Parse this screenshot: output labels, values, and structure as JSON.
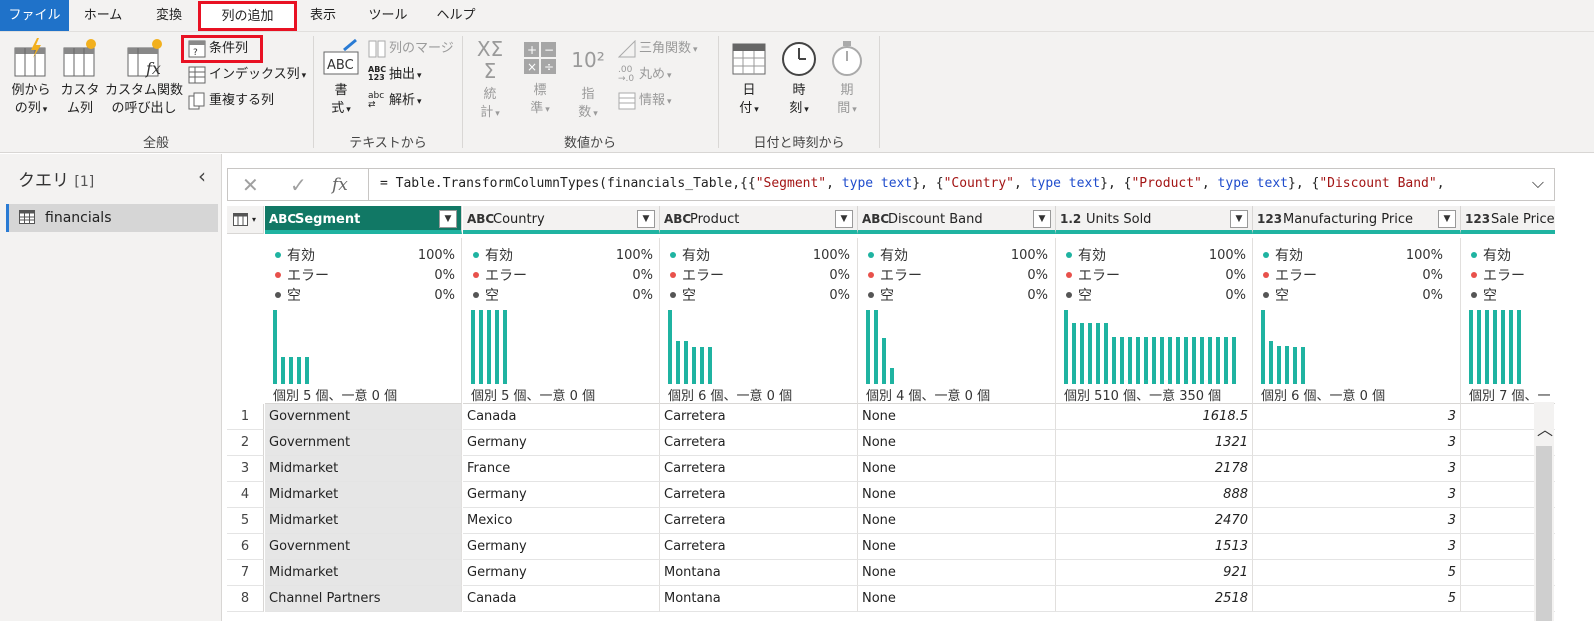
{
  "menu": {
    "file": "ファイル",
    "home": "ホーム",
    "transform": "変換",
    "add_column": "列の追加",
    "view": "表示",
    "tools": "ツール",
    "help": "ヘルプ"
  },
  "ribbon": {
    "general": {
      "label": "全般",
      "from_examples": [
        "例から",
        "の列"
      ],
      "custom_column": [
        "カスタ",
        "ム列"
      ],
      "invoke_custom_function": [
        "カスタム関数",
        "の呼び出し"
      ],
      "conditional_column": "条件列",
      "index_column": "インデックス列",
      "duplicate_column": "重複する列"
    },
    "from_text": {
      "label": "テキストから",
      "format": [
        "書",
        "式"
      ],
      "merge_columns": "列のマージ",
      "extract": "抽出",
      "parse": "解析"
    },
    "from_number": {
      "label": "数値から",
      "statistics": [
        "統",
        "計"
      ],
      "standard": [
        "標",
        "準"
      ],
      "scientific": [
        "指",
        "数"
      ],
      "trigonometry": "三角関数",
      "rounding": "丸め",
      "information": "情報"
    },
    "from_datetime": {
      "label": "日付と時刻から",
      "date": [
        "日",
        "付"
      ],
      "time": [
        "時",
        "刻"
      ],
      "duration": [
        "期",
        "間"
      ]
    }
  },
  "queries": {
    "title": "クエリ",
    "count": "[1]",
    "items": [
      "financials"
    ]
  },
  "formula": {
    "prefix": "= Table.TransformColumnTypes(financials_Table,{{",
    "parts": [
      {
        "t": "str",
        "v": "\"Segment\""
      },
      {
        "t": "plain",
        "v": ", "
      },
      {
        "t": "kw",
        "v": "type text"
      },
      {
        "t": "plain",
        "v": "}, {"
      },
      {
        "t": "str",
        "v": "\"Country\""
      },
      {
        "t": "plain",
        "v": ", "
      },
      {
        "t": "kw",
        "v": "type text"
      },
      {
        "t": "plain",
        "v": "}, {"
      },
      {
        "t": "str",
        "v": "\"Product\""
      },
      {
        "t": "plain",
        "v": ", "
      },
      {
        "t": "kw",
        "v": "type text"
      },
      {
        "t": "plain",
        "v": "}, {"
      },
      {
        "t": "str",
        "v": "\"Discount Band\""
      },
      {
        "t": "plain",
        "v": ","
      }
    ]
  },
  "profile_labels": {
    "valid": "有効",
    "error": "エラー",
    "empty": "空"
  },
  "columns": [
    {
      "name": "Segment",
      "type": "ABC",
      "valid": "100%",
      "error": "0%",
      "empty": "0%",
      "distinct": "個別 5 個、一意 0 個",
      "bars": [
        1.0,
        0.36,
        0.36,
        0.36,
        0.36
      ]
    },
    {
      "name": "Country",
      "type": "ABC",
      "valid": "100%",
      "error": "0%",
      "empty": "0%",
      "distinct": "個別 5 個、一意 0 個",
      "bars": [
        1.0,
        1.0,
        1.0,
        1.0,
        1.0
      ]
    },
    {
      "name": "Product",
      "type": "ABC",
      "valid": "100%",
      "error": "0%",
      "empty": "0%",
      "distinct": "個別 6 個、一意 0 個",
      "bars": [
        1.0,
        0.58,
        0.58,
        0.5,
        0.5,
        0.5
      ]
    },
    {
      "name": "Discount Band",
      "type": "ABC",
      "valid": "100%",
      "error": "0%",
      "empty": "0%",
      "distinct": "個別 4 個、一意 0 個",
      "bars": [
        1.0,
        1.0,
        0.62,
        0.22
      ]
    },
    {
      "name": "Units Sold",
      "type": "1.2",
      "valid": "100%",
      "error": "0%",
      "empty": "0%",
      "distinct": "個別 510 個、一意 350 個",
      "bars": [
        1.0,
        0.82,
        0.82,
        0.82,
        0.82,
        0.82,
        0.63,
        0.63,
        0.63,
        0.63,
        0.63,
        0.63,
        0.63,
        0.63,
        0.63,
        0.63,
        0.63,
        0.63,
        0.63,
        0.63,
        0.63,
        0.63
      ]
    },
    {
      "name": "Manufacturing Price",
      "type": "123",
      "valid": "100%",
      "error": "0%",
      "empty": "0%",
      "distinct": "個別 6 個、一意 0 個",
      "bars": [
        1.0,
        0.58,
        0.52,
        0.52,
        0.5,
        0.5
      ]
    },
    {
      "name": "Sale Price",
      "type": "123",
      "valid": "100%",
      "error": "0%",
      "empty": "0%",
      "distinct": "個別 7 個、一",
      "bars": [
        1.0,
        1.0,
        1.0,
        1.0,
        1.0,
        1.0,
        1.0
      ]
    }
  ],
  "rows": [
    {
      "n": "1",
      "segment": "Government",
      "country": "Canada",
      "product": "Carretera",
      "discount": "None",
      "units": "1618.5",
      "mfg": "3"
    },
    {
      "n": "2",
      "segment": "Government",
      "country": "Germany",
      "product": "Carretera",
      "discount": "None",
      "units": "1321",
      "mfg": "3"
    },
    {
      "n": "3",
      "segment": "Midmarket",
      "country": "France",
      "product": "Carretera",
      "discount": "None",
      "units": "2178",
      "mfg": "3"
    },
    {
      "n": "4",
      "segment": "Midmarket",
      "country": "Germany",
      "product": "Carretera",
      "discount": "None",
      "units": "888",
      "mfg": "3"
    },
    {
      "n": "5",
      "segment": "Midmarket",
      "country": "Mexico",
      "product": "Carretera",
      "discount": "None",
      "units": "2470",
      "mfg": "3"
    },
    {
      "n": "6",
      "segment": "Government",
      "country": "Germany",
      "product": "Carretera",
      "discount": "None",
      "units": "1513",
      "mfg": "3"
    },
    {
      "n": "7",
      "segment": "Midmarket",
      "country": "Germany",
      "product": "Montana",
      "discount": "None",
      "units": "921",
      "mfg": "5"
    },
    {
      "n": "8",
      "segment": "Channel Partners",
      "country": "Canada",
      "product": "Montana",
      "discount": "None",
      "units": "2518",
      "mfg": "5"
    }
  ],
  "colors": {
    "accent": "#1fb3a1",
    "selected_header": "#117865",
    "file_tab": "#1f72c9",
    "highlight": "#e81123",
    "valid_dot": "#1fb3a1",
    "error_dot": "#e8514b",
    "empty_dot": "#555555"
  }
}
